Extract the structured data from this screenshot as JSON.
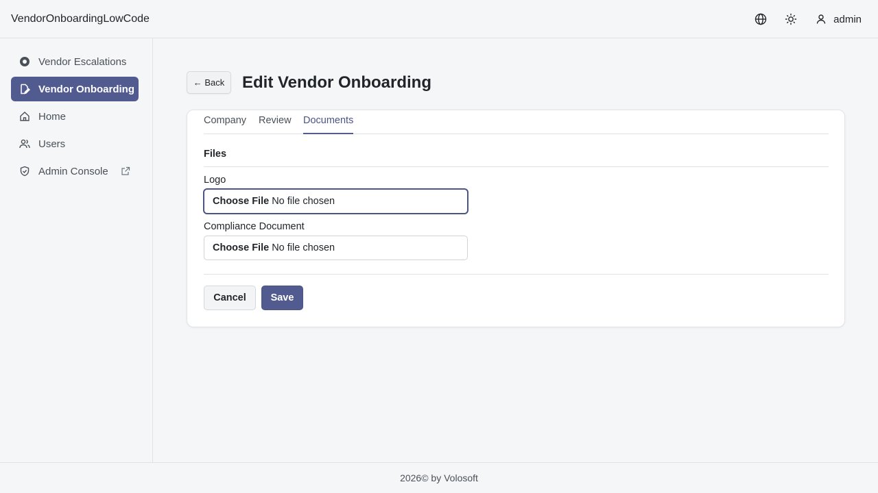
{
  "app": {
    "title": "VendorOnboardingLowCode"
  },
  "topbar": {
    "language_icon": "globe-icon",
    "theme_icon": "sun-icon",
    "user_icon": "user-icon",
    "user_name": "admin"
  },
  "sidebar": {
    "items": [
      {
        "label": "Vendor Escalations",
        "icon": "record-circle-icon",
        "active": false
      },
      {
        "label": "Vendor Onboarding",
        "icon": "pencil-document-icon",
        "active": true
      },
      {
        "label": "Home",
        "icon": "home-icon",
        "active": false
      },
      {
        "label": "Users",
        "icon": "users-icon",
        "active": false
      },
      {
        "label": "Admin Console",
        "icon": "shield-check-icon",
        "active": false,
        "external": true
      }
    ]
  },
  "page": {
    "back_label": "← Back",
    "title": "Edit Vendor Onboarding"
  },
  "tabs": [
    {
      "label": "Company",
      "active": false
    },
    {
      "label": "Review",
      "active": false
    },
    {
      "label": "Documents",
      "active": true
    }
  ],
  "form": {
    "section_title": "Files",
    "fields": [
      {
        "label": "Logo",
        "button": "Choose File",
        "value": "No file chosen",
        "focused": true
      },
      {
        "label": "Compliance Document",
        "button": "Choose File",
        "value": "No file chosen",
        "focused": false
      }
    ],
    "cancel_label": "Cancel",
    "save_label": "Save"
  },
  "footer": {
    "text": "2026© by Volosoft"
  },
  "colors": {
    "accent": "#525b8f",
    "background": "#f5f6f8",
    "card": "#ffffff"
  }
}
